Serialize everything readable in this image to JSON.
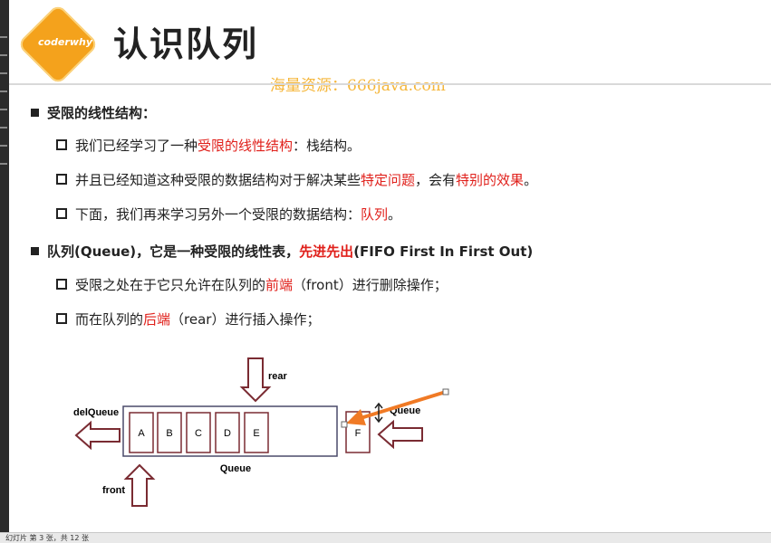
{
  "slide": {
    "logo_text": "coderwhy",
    "title": "认识队列",
    "watermark": "海量资源：666java.com"
  },
  "bullets": {
    "b1": "受限的线性结构：",
    "b1_1_pre": "我们已经学习了一种",
    "b1_1_red": "受限的线性结构",
    "b1_1_post": "：栈结构。",
    "b1_2_pre": "并且已经知道这种受限的数据结构对于解决某些",
    "b1_2_red1": "特定问题",
    "b1_2_mid": "，会有",
    "b1_2_red2": "特别的效果",
    "b1_2_post": "。",
    "b1_3_pre": "下面，我们再来学习另外一个受限的数据结构：",
    "b1_3_red": "队列",
    "b1_3_post": "。",
    "b2_pre": "队列(Queue)，它是一种受限的线性表，",
    "b2_red": "先进先出",
    "b2_post": "(FIFO First In First Out)",
    "b2_1_pre": "受限之处在于它只允许在队列的",
    "b2_1_red": "前端",
    "b2_1_post": "（front）进行删除操作；",
    "b2_2_pre": "而在队列的",
    "b2_2_red": "后端",
    "b2_2_post": "（rear）进行插入操作；"
  },
  "diagram": {
    "rear_label": "rear",
    "front_label": "front",
    "del_label": "delQueue",
    "en_label": "Queue",
    "queue_label": "Queue",
    "items": [
      "A",
      "B",
      "C",
      "D",
      "E"
    ],
    "new_item": "F"
  },
  "statusbar": {
    "text": "幻灯片 第 3 张，共 12 张"
  },
  "colors": {
    "accent_red": "#e0201b",
    "logo_orange": "#f4a21c",
    "arrow_outline": "#7a2b32",
    "annotation_arrow": "#f07a25",
    "watermark": "#f5b63a"
  }
}
